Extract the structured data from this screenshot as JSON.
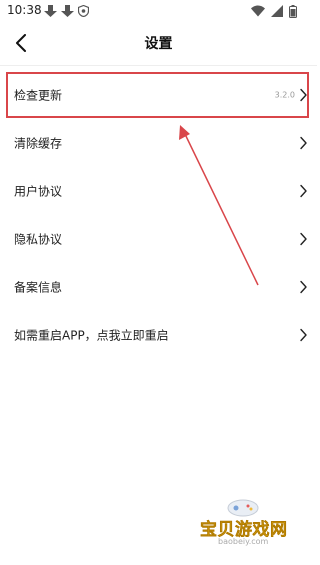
{
  "status_bar": {
    "time": "10:38",
    "left_icons": [
      "nav-icon",
      "nav-icon",
      "shield-icon"
    ],
    "right_icons": [
      "wifi-icon",
      "signal-icon",
      "battery-icon"
    ]
  },
  "header": {
    "title": "设置",
    "back_icon": "chevron-left-icon"
  },
  "menu": {
    "items": [
      {
        "label": "检查更新",
        "value": "3.2.0",
        "icon": "chevron-right-icon"
      },
      {
        "label": "清除缓存",
        "value": "",
        "icon": "chevron-right-icon"
      },
      {
        "label": "用户协议",
        "value": "",
        "icon": "chevron-right-icon"
      },
      {
        "label": "隐私协议",
        "value": "",
        "icon": "chevron-right-icon"
      },
      {
        "label": "备案信息",
        "value": "",
        "icon": "chevron-right-icon"
      },
      {
        "label": "如需重启APP，点我立即重启",
        "value": "",
        "icon": "chevron-right-icon"
      }
    ]
  },
  "annotation": {
    "color": "#d9464a"
  },
  "watermark": {
    "text": "宝贝游戏网",
    "url": "baobeiy.com",
    "color": "#f4c01e"
  }
}
